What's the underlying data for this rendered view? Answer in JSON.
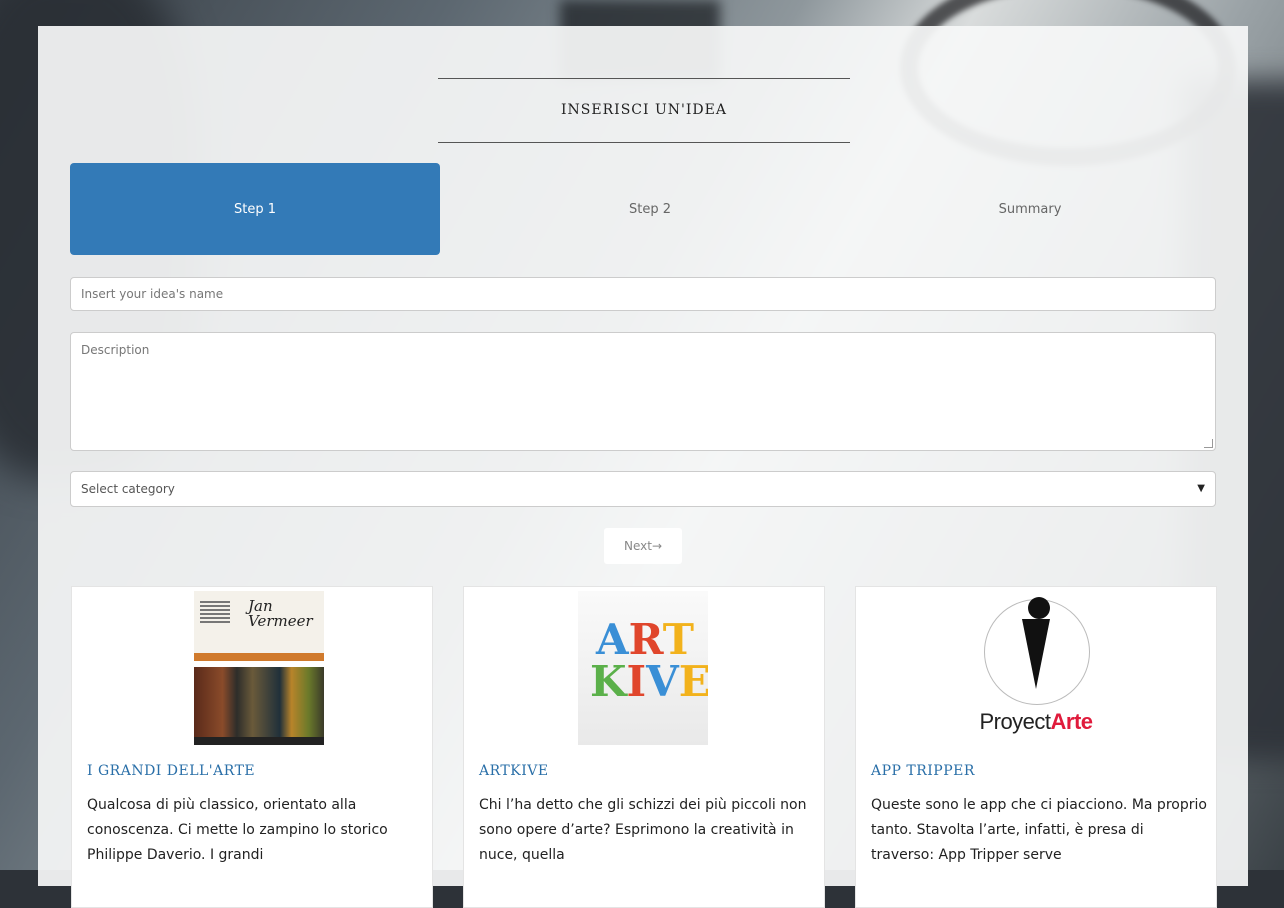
{
  "form": {
    "heading": "INSERISCI UN'IDEA",
    "steps": [
      {
        "label": "Step 1",
        "active": true
      },
      {
        "label": "Step 2",
        "active": false
      },
      {
        "label": "Summary",
        "active": false
      }
    ],
    "name_placeholder": "Insert your idea's name",
    "description_placeholder": "Description",
    "category_selected": "Select category",
    "next_label": "Next→"
  },
  "cards": [
    {
      "title": "I GRANDI DELL'ARTE",
      "image": "vermeer-app-thumbnail",
      "image_text": "Jan Vermeer",
      "text": "Qualcosa di più classico, orientato alla conoscenza. Ci mette lo zampino lo storico Philippe Daverio. I grandi"
    },
    {
      "title": "ARTKIVE",
      "image": "artkive-logo",
      "image_text": "ART KIVE",
      "text": "Chi l’ha detto che gli schizzi dei più piccoli non sono opere d’arte? Esprimono la creatività in nuce, quella"
    },
    {
      "title": "APP TRIPPER",
      "image": "proyectarte-logo",
      "image_text_a": "Proyect",
      "image_text_b": "Arte",
      "text": "Queste sono le app che ci piacciono. Ma proprio tanto. Stavolta l’arte, infatti, è presa di traverso: App Tripper serve"
    }
  ],
  "colors": {
    "accent": "#337ab7",
    "card_title": "#2a6fa8",
    "logo_red": "#e01b3c"
  }
}
